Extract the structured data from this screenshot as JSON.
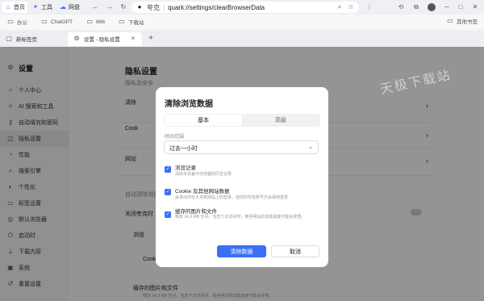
{
  "browser": {
    "nav_tabs": [
      {
        "label": "首页",
        "icon": "home-icon"
      },
      {
        "label": "工具",
        "icon": "tools-icon"
      },
      {
        "label": "网盘",
        "icon": "cloud-drive-icon"
      }
    ],
    "search_engine": "夸克",
    "address": "quark://settings/clearBrowserData",
    "bookmarks": [
      "办公",
      "ChatGPT",
      "666",
      "下载站"
    ],
    "other_bookmarks": "其他书签",
    "tabs": [
      {
        "label": "新标签页"
      },
      {
        "label": "设置 - 隐私设置"
      }
    ]
  },
  "sidebar": {
    "title": "设置",
    "items": [
      {
        "label": "个人中心",
        "icon": "user-icon"
      },
      {
        "label": "AI 搜索和工具",
        "icon": "ai-icon"
      },
      {
        "label": "自动填充和密码",
        "icon": "key-icon"
      },
      {
        "label": "隐私设置",
        "icon": "privacy-icon",
        "active": true
      },
      {
        "label": "性能",
        "icon": "performance-icon"
      },
      {
        "label": "搜索引擎",
        "icon": "search-icon"
      },
      {
        "label": "个性化",
        "icon": "palette-icon"
      },
      {
        "label": "标签设置",
        "icon": "tab-icon"
      },
      {
        "label": "默认浏览器",
        "icon": "browser-icon"
      },
      {
        "label": "启动时",
        "icon": "power-icon"
      },
      {
        "label": "下载内容",
        "icon": "download-icon"
      },
      {
        "label": "系统",
        "icon": "system-icon"
      },
      {
        "label": "重置设置",
        "icon": "reset-icon"
      }
    ]
  },
  "main": {
    "title": "隐私设置",
    "section": "隐私及安全",
    "rows": [
      "清除",
      "Cook",
      "网站"
    ],
    "auto_clear_section": "自动清除浏览",
    "close_label": "关闭夸克时",
    "bg_options": [
      "浏览",
      "Cook",
      "缓存的图片和文件"
    ],
    "bg_desc": "释放 34.3 MB 空间。当您下次访问时，某些网站的加载速度可能会变慢。"
  },
  "watermark": "天极下载站",
  "dialog": {
    "title": "清除浏览数据",
    "tabs": {
      "basic": "基本",
      "advanced": "高级"
    },
    "time_range_label": "时间范围",
    "time_range_value": "过去一小时",
    "options": [
      {
        "title": "浏览记录",
        "desc": "清除本设备中浏览器的历史记录",
        "checked": true
      },
      {
        "title": "Cookie 及其他网站数据",
        "desc": "会退出你在大多数网站上的登录，但你的夸克账号仍会保持登录",
        "checked": true
      },
      {
        "title": "缓存的图片和文件",
        "desc": "释放 34.3 MB 空间。当您下次访问时，某些网站的加载速度可能会变慢。",
        "checked": true
      }
    ],
    "confirm": "清除数据",
    "cancel": "取消"
  }
}
